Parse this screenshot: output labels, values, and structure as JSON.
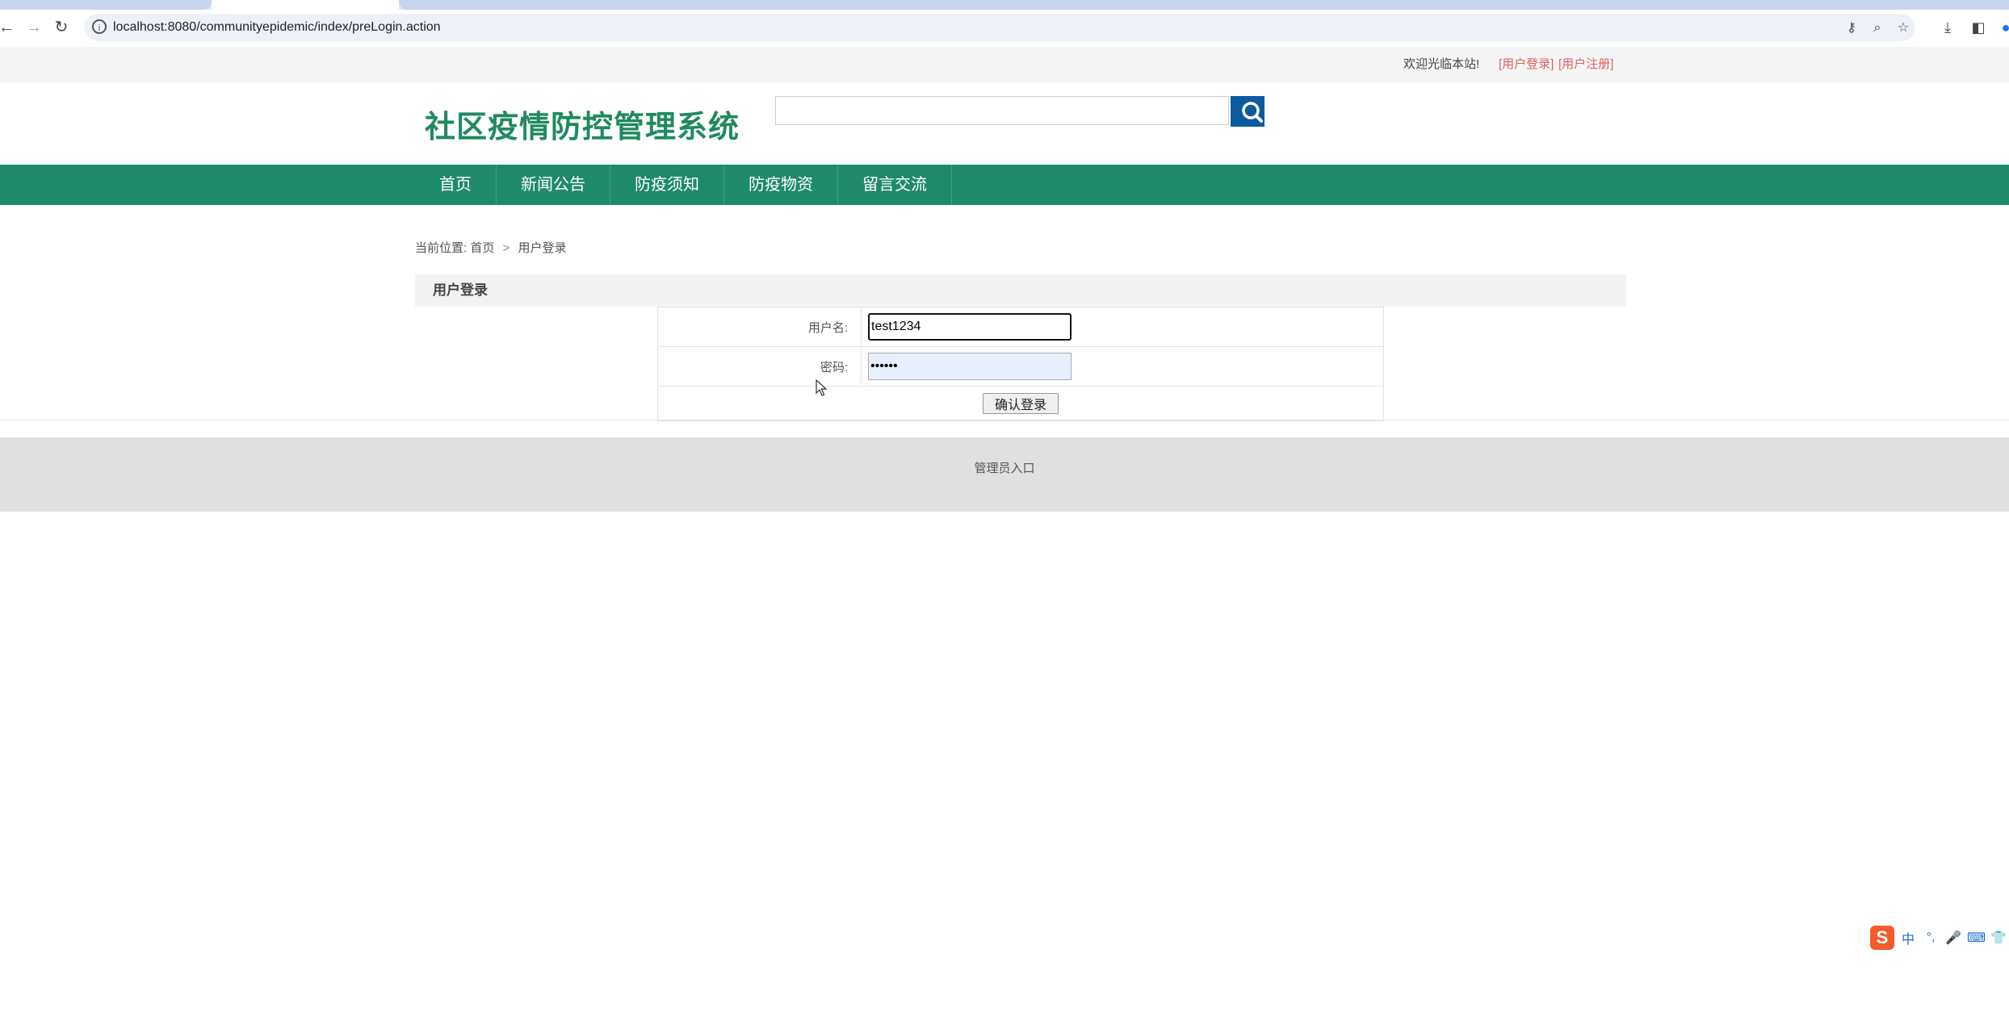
{
  "browser": {
    "url": "localhost:8080/communityepidemic/index/preLogin.action"
  },
  "topbar": {
    "welcome": "欢迎光临本站!",
    "login_link": "[用户登录]",
    "register_link": "[用户注册]"
  },
  "header": {
    "logo": "社区疫情防控管理系统",
    "search_value": ""
  },
  "nav": {
    "items": [
      {
        "label": "首页"
      },
      {
        "label": "新闻公告"
      },
      {
        "label": "防疫须知"
      },
      {
        "label": "防疫物资"
      },
      {
        "label": "留言交流"
      }
    ]
  },
  "breadcrumb": {
    "prefix": "当前位置:",
    "home": "首页",
    "separator": ">",
    "current": "用户登录"
  },
  "section": {
    "title": "用户登录"
  },
  "form": {
    "username_label": "用户名:",
    "username_value": "test1234",
    "password_label": "密码:",
    "password_value": "••••••",
    "submit_label": "确认登录"
  },
  "footer": {
    "admin_link": "管理员入口"
  },
  "ime": {
    "logo": "S",
    "mode": "中",
    "punct": "°,",
    "mic": "🎤",
    "keyboard": "⌨",
    "skin": "👕",
    "more": "☺"
  },
  "colors": {
    "brand_green": "#1f8a6a",
    "logo_green": "#1f8a60",
    "search_blue": "#0d5aa1",
    "link_red": "#e06060"
  }
}
